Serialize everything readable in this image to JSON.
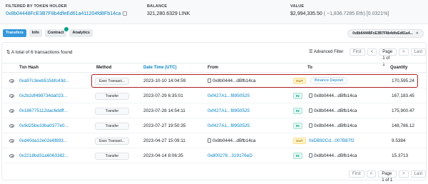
{
  "header": {
    "filtered_label": "FILTERED BY TOKEN HOLDER",
    "filtered_value": "0x8b04448FcE3B7F8b4dfeEd61a411204fd8Fb14ca",
    "balance_label": "BALANCE",
    "balance_value": "321,280.6329 LINK",
    "value_label": "VALUE",
    "value_amount": "$2,994,335.50",
    "value_detail": "( ~1,836.7285 Eth) [0.0321%]"
  },
  "tabs": [
    {
      "label": "Transfers"
    },
    {
      "label": "Info"
    },
    {
      "label": "Contract"
    },
    {
      "label": "Analytics"
    }
  ],
  "filter_address_pill": "0x8b64448FcE3B7F8b4dfeEd61a4...",
  "filter_pill_close": "✕",
  "summary": "A total of 6 transactions found",
  "advanced_filter": "Advanced Filter",
  "pager": {
    "first": "First",
    "prev": "<",
    "page": "Page 1 of 1",
    "next": ">",
    "last": "Last"
  },
  "columns": {
    "txn_hash": "Txn Hash",
    "method": "Method",
    "datetime": "Date Time (UTC)",
    "from": "From",
    "to": "To",
    "quantity": "Quantity"
  },
  "rows": [
    {
      "hash": "0xa97c3eeb515bfc43d...",
      "method": "Exec Transact...",
      "datetime": "2023-10-10 14:04:59",
      "from": "0x8b0444...dBfb14ca",
      "from_link": false,
      "dir": "OUT",
      "to": "Binance Deposit",
      "to_is_pill": true,
      "qty": "170,595.24"
    },
    {
      "hash": "0x2b2df498734da023...",
      "method": "Transfer",
      "datetime": "2023-07-29 6:35:01",
      "from": "0xf427A1...f8950525",
      "from_link": true,
      "dir": "IN",
      "to": "0x8b0444...dBfb14ca",
      "to_is_pill": false,
      "qty": "167,183.45"
    },
    {
      "hash": "0x186775112dac6ddff...",
      "method": "Transfer",
      "datetime": "2023-07-28 14:54:11",
      "from": "0xf427A1...f8950525",
      "from_link": true,
      "dir": "IN",
      "to": "0x8b0444...dBfb14ca",
      "to_is_pill": false,
      "qty": "175,900.47"
    },
    {
      "hash": "0x9d25be33ba0377e0...",
      "method": "Transfer",
      "datetime": "2023-07-27 19:50:35",
      "from": "0xf427A1...f8950525",
      "from_link": true,
      "dir": "IN",
      "to": "0x8b0444...dBfb14ca",
      "to_is_pill": false,
      "qty": "148,786.12"
    },
    {
      "hash": "0xd40da12e02e6f893...",
      "method": "Exec Transact...",
      "datetime": "2023-04-27 15:09:11",
      "from": "0x8b0444...dBfb14ca",
      "from_link": false,
      "dir": "OUT",
      "to": "0xDB92Cd...007B87f2",
      "to_is_pill": false,
      "qty": "9.5384"
    },
    {
      "hash": "0x2218bd31a6063382...",
      "method": "Transfer",
      "datetime": "2023-04-14 8:06:35",
      "from": "0x800278...319176eD",
      "from_link": true,
      "dir": "IN",
      "to": "0x8b0444...dBfb14ca",
      "to_is_pill": false,
      "qty": "15.3713"
    }
  ],
  "icons": {
    "copy": "copy-icon",
    "sort": "sort-desc-icon",
    "filter": "filter-icon",
    "eye": "eye-icon",
    "doc": "contract-doc-icon",
    "check": "verified-check-icon"
  },
  "colors": {
    "accent": "#3498db",
    "link": "#0784c3",
    "in": "#00a186",
    "out": "#b78103",
    "highlight": "#b22222"
  }
}
